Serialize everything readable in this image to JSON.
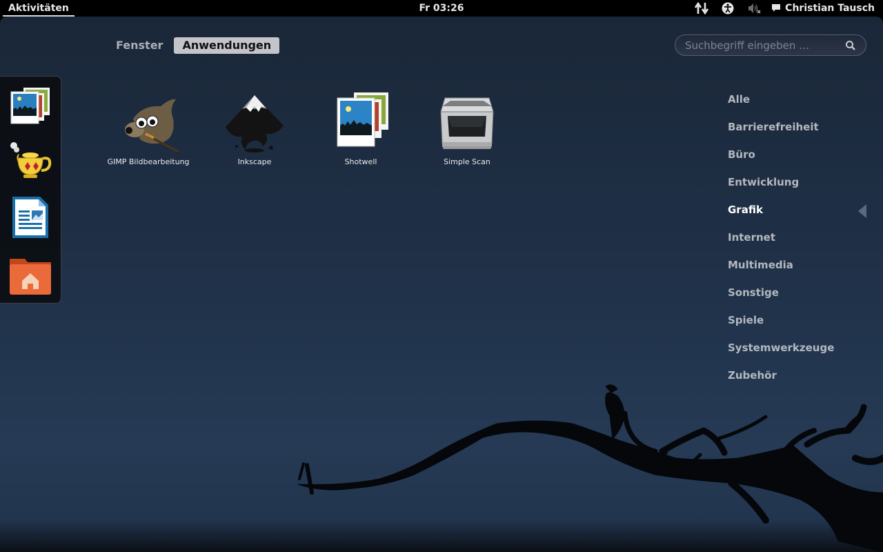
{
  "top_panel": {
    "activities": "Aktivitäten",
    "clock": "Fr 03:26",
    "user": "Christian Tausch",
    "icons": [
      "network-arrows-icon",
      "accessibility-icon",
      "volume-muted-icon",
      "chat-bubble-icon"
    ]
  },
  "view_tabs": [
    {
      "label": "Fenster",
      "active": false
    },
    {
      "label": "Anwendungen",
      "active": true
    }
  ],
  "search": {
    "placeholder": "Suchbegriff eingeben …"
  },
  "dash": [
    "shotwell-icon",
    "teapot-icon",
    "libreoffice-writer-icon",
    "home-folder-icon"
  ],
  "apps": [
    {
      "label": "GIMP Bildbearbeitung",
      "icon": "gimp-icon"
    },
    {
      "label": "Inkscape",
      "icon": "inkscape-icon"
    },
    {
      "label": "Shotwell",
      "icon": "shotwell-icon"
    },
    {
      "label": "Simple Scan",
      "icon": "scanner-icon"
    }
  ],
  "categories": [
    {
      "label": "Alle",
      "active": false
    },
    {
      "label": "Barrierefreiheit",
      "active": false
    },
    {
      "label": "Büro",
      "active": false
    },
    {
      "label": "Entwicklung",
      "active": false
    },
    {
      "label": "Grafik",
      "active": true
    },
    {
      "label": "Internet",
      "active": false
    },
    {
      "label": "Multimedia",
      "active": false
    },
    {
      "label": "Sonstige",
      "active": false
    },
    {
      "label": "Spiele",
      "active": false
    },
    {
      "label": "Systemwerkzeuge",
      "active": false
    },
    {
      "label": "Zubehör",
      "active": false
    }
  ],
  "tray": {
    "dropbox": "dropbox"
  },
  "colors": {
    "background": "#1f3047",
    "panel": "#000000",
    "active_tab": "#c3c5c9"
  }
}
